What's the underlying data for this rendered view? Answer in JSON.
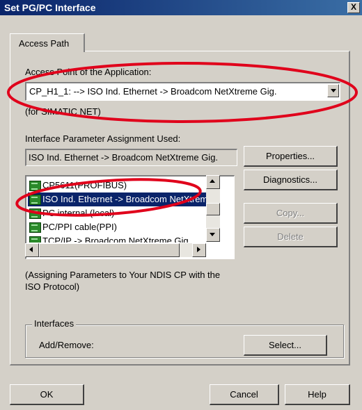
{
  "window": {
    "title": "Set PG/PC Interface",
    "close_glyph": "X"
  },
  "tabs": [
    {
      "label": "Access Path"
    }
  ],
  "access_point": {
    "label": "Access Point of the Application:",
    "value": "CP_H1_1:       --> ISO Ind. Ethernet -> Broadcom NetXtreme Gig.",
    "hint": "(for SIMATIC NET)"
  },
  "interface_param": {
    "label": "Interface Parameter Assignment Used:",
    "value": "ISO Ind. Ethernet -> Broadcom NetXtreme Gig."
  },
  "list": {
    "items": [
      {
        "label": "CP5611(PROFIBUS)",
        "icon": "network-card-icon"
      },
      {
        "label": "ISO Ind. Ethernet -> Broadcom NetXtreme Gig.",
        "icon": "network-card-icon",
        "selected": true
      },
      {
        "label": "PC internal (local)",
        "icon": "network-card-icon"
      },
      {
        "label": "PC/PPI cable(PPI)",
        "icon": "network-card-icon"
      },
      {
        "label": "TCP/IP -> Broadcom NetXtreme Gig.",
        "icon": "network-card-icon"
      }
    ]
  },
  "buttons": {
    "properties": "Properties...",
    "diagnostics": "Diagnostics...",
    "copy": "Copy...",
    "delete": "Delete",
    "select": "Select...",
    "ok": "OK",
    "cancel": "Cancel",
    "help": "Help"
  },
  "assign_note": "(Assigning Parameters to Your NDIS CP with the ISO Protocol)",
  "interfaces": {
    "group_label": "Interfaces",
    "add_remove": "Add/Remove:"
  },
  "colors": {
    "dialog": "#d4d0c8",
    "titlebar": "#0a246a",
    "selection": "#0a246a",
    "annotation": "#e0001b"
  }
}
